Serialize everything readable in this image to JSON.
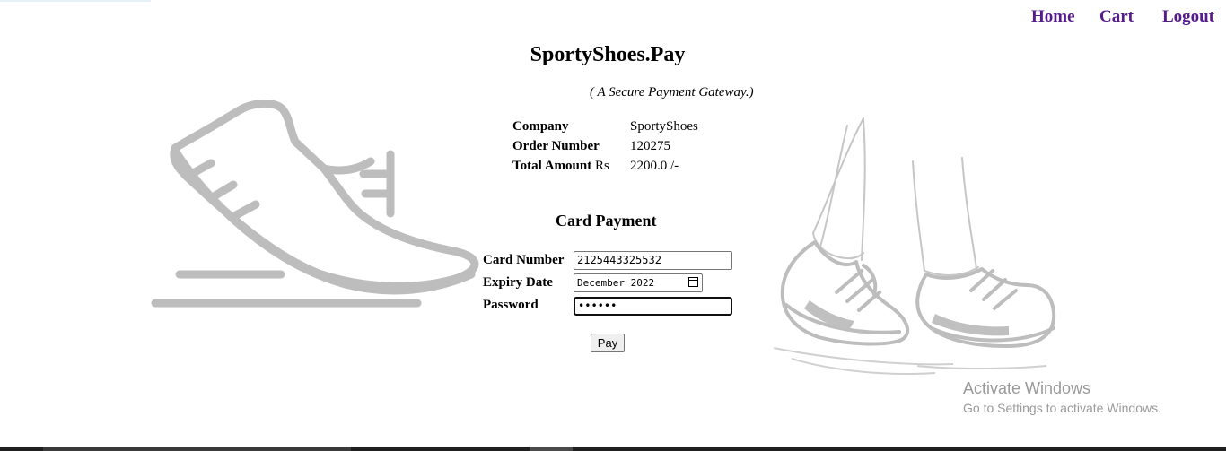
{
  "nav": {
    "home": "Home",
    "cart": "Cart",
    "logout": "Logout"
  },
  "header": {
    "title": "SportyShoes.Pay",
    "subtitle": "( A Secure Payment Gateway.)"
  },
  "order_info": {
    "company_label": "Company",
    "company_value": "SportyShoes",
    "order_label": "Order Number",
    "order_value": "120275",
    "amount_label": "Total Amount",
    "amount_unit": "Rs",
    "amount_value": "2200.0 /-"
  },
  "card_payment": {
    "title": "Card Payment",
    "card_number_label": "Card Number",
    "card_number_value": "2125443325532",
    "expiry_label": "Expiry Date",
    "expiry_value": "December 2022",
    "password_label": "Password",
    "password_value": "••••••",
    "pay_label": "Pay"
  },
  "watermark": {
    "line1": "Activate Windows",
    "line2": "Go to Settings to activate Windows."
  },
  "icons": [
    "running-shoe-icon",
    "walking-sneakers-icon",
    "calendar-icon"
  ],
  "colors": {
    "link": "#551a8b",
    "illustration": "#bdbdbd",
    "watermark": "#9a9a9a"
  }
}
